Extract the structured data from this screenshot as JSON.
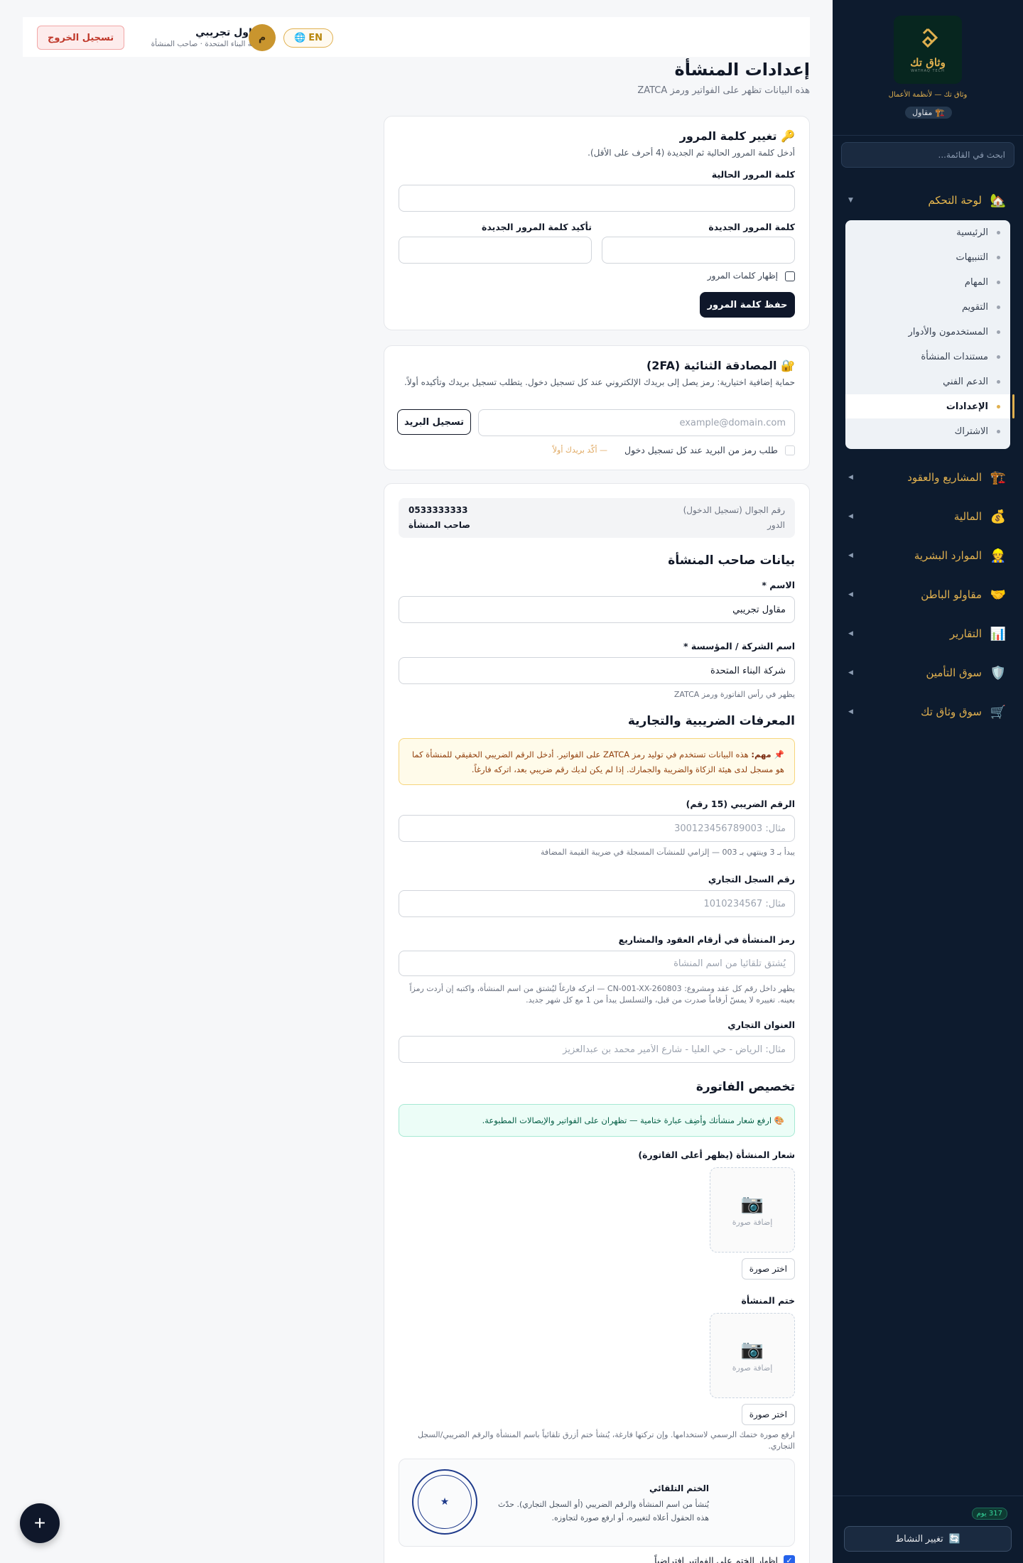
{
  "sidebar": {
    "brand_name": "وثاق تك",
    "brand_sub": "WATHAQ TECH",
    "brand_tagline": "وثاق تك — لأنظمة الأعمال",
    "role_chip": "مقاول",
    "search_placeholder": "ابحث في القائمة...",
    "groups": [
      {
        "label": "لوحة التحكم",
        "icon": "🏡"
      },
      {
        "label": "المشاريع والعقود",
        "icon": "🏗️"
      },
      {
        "label": "المالية",
        "icon": "💰"
      },
      {
        "label": "الموارد البشرية",
        "icon": "👷"
      },
      {
        "label": "مقاولو الباطن",
        "icon": "🤝"
      },
      {
        "label": "التقارير",
        "icon": "📊"
      },
      {
        "label": "سوق التأمين",
        "icon": "🛡️"
      },
      {
        "label": "سوق وثاق تك",
        "icon": "🛒"
      }
    ],
    "sub_items": [
      "الرئيسية",
      "التنبيهات",
      "المهام",
      "التقويم",
      "المستخدمون والأدوار",
      "مستندات المنشأة",
      "الدعم الفني",
      "الإعدادات",
      "الاشتراك"
    ],
    "active_sub_index": 7,
    "days_badge": "317 يوم",
    "switch_activity": "تغيير النشاط"
  },
  "topbar": {
    "logout": "تسجيل الخروج",
    "user_name": "مقاول تجريبي",
    "user_sub": "شركة البناء المتحدة · صاحب المنشأة",
    "avatar_initial": "م",
    "lang": "EN"
  },
  "page": {
    "title": "إعدادات المنشأة",
    "subtitle": "هذه البيانات تظهر على الفواتير ورمز ZATCA"
  },
  "password_card": {
    "title": "🔑 تغيير كلمة المرور",
    "desc": "أدخل كلمة المرور الحالية ثم الجديدة (4 أحرف على الأقل).",
    "current_label": "كلمة المرور الحالية",
    "new_label": "كلمة المرور الجديدة",
    "confirm_label": "تأكيد كلمة المرور الجديدة",
    "show_label": "إظهار كلمات المرور",
    "save": "حفظ كلمة المرور"
  },
  "twofa_card": {
    "title": "🔐 المصادقة الثنائية (2FA)",
    "desc": "حماية إضافية اختيارية: رمز يصل إلى بريدك الإلكتروني عند كل تسجيل دخول. يتطلب تسجيل بريدك وتأكيده أولاً.",
    "email_placeholder": "example@domain.com",
    "register_email": "تسجيل البريد",
    "require_code_label": "طلب رمز من البريد عند كل تسجيل دخول",
    "confirm_first": "— أكّد بريدك أولاً"
  },
  "owner_card": {
    "phone_key": "رقم الجوال (تسجيل الدخول)",
    "phone_value": "0533333333",
    "role_key": "الدور",
    "role_value": "صاحب المنشأة",
    "owner_section": "بيانات صاحب المنشأة",
    "name_label": "الاسم *",
    "name_value": "مقاول تجريبي",
    "company_label": "اسم الشركة / المؤسسة *",
    "company_value": "شركة البناء المتحدة",
    "company_hint": "يظهر في رأس الفاتورة ورمز ZATCA",
    "tax_section": "المعرفات الضريبية والتجارية",
    "warn_bold": "📌 مهم:",
    "warn_text": "هذه البيانات تستخدم في توليد رمز ZATCA على الفواتير. أدخل الرقم الضريبي الحقيقي للمنشأة كما هو مسجل لدى هيئة الزكاة والضريبة والجمارك. إذا لم يكن لديك رقم ضريبي بعد، اتركه فارغاً.",
    "vat_label": "الرقم الضريبي (15 رقم)",
    "vat_placeholder": "مثال: 300123456789003",
    "vat_hint": "يبدأ بـ 3 وينتهي بـ 003 — إلزامي للمنشآت المسجلة في ضريبة القيمة المضافة",
    "cr_label": "رقم السجل التجاري",
    "cr_placeholder": "مثال: 1010234567",
    "code_label": "رمز المنشأة في أرقام العقود والمشاريع",
    "code_placeholder": "يُشتق تلقائياً من اسم المنشأة",
    "code_hint": "يظهر داخل رقم كل عقد ومشروع: CN-001-XX-260803 — اتركه فارغاً ليُشتق من اسم المنشأة، واكتبه إن أردت رمزاً بعينه. تغييره لا يمسّ أرقاماً صدرت من قبل، والتسلسل يبدأ من 1 مع كل شهر جديد.",
    "address_label": "العنوان التجاري",
    "address_placeholder": "مثال: الرياض - حي العليا - شارع الأمير محمد بن عبدالعزيز",
    "invoice_section": "تخصيص الفاتورة",
    "invoice_note": "🎨 ارفع شعار منشأتك وأضِف عبارة ختامية — تظهران على الفواتير والإيصالات المطبوعة.",
    "logo_label": "شعار المنشأة (يظهر أعلى الفاتورة)",
    "add_image": "إضافة صورة",
    "choose_image": "اختر صورة",
    "seal_label": "ختم المنشأة",
    "seal_hint": "ارفع صورة ختمك الرسمي لاستخدامها. وإن تركتها فارغة، يُنشأ ختم أزرق تلقائياً باسم المنشأة والرقم الضريبي/السجل التجاري.",
    "auto_seal_title": "الختم التلقائي",
    "auto_seal_desc": "يُنشأ من اسم المنشأة والرقم الضريبي (أو السجل التجاري). حدّث هذه الحقول أعلاه لتغييره، أو ارفع صورة لتجاوزه.",
    "show_seal_label": "إظهار الختم على الفواتير افتراضياً"
  },
  "fab": "+"
}
